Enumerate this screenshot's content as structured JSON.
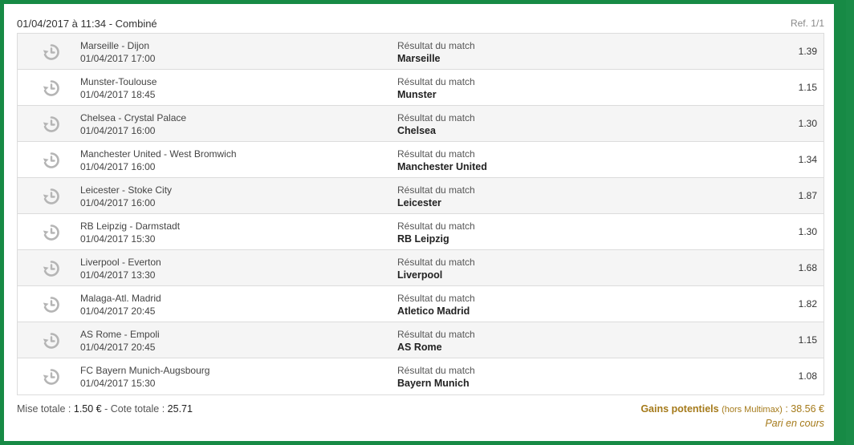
{
  "header": {
    "title": "01/04/2017 à 11:34 - Combiné",
    "ref": "Ref. 1/1"
  },
  "colors": {
    "frame": "#178a45",
    "row_alt": "#f5f5f5",
    "gains": "#a57a1a"
  },
  "icon": "history-icon",
  "bets": [
    {
      "match": "Marseille - Dijon",
      "date": "01/04/2017 17:00",
      "market": "Résultat du match",
      "pick": "Marseille",
      "odds": "1.39"
    },
    {
      "match": "Munster-Toulouse",
      "date": "01/04/2017 18:45",
      "market": "Résultat du match",
      "pick": "Munster",
      "odds": "1.15"
    },
    {
      "match": "Chelsea - Crystal Palace",
      "date": "01/04/2017 16:00",
      "market": "Résultat du match",
      "pick": "Chelsea",
      "odds": "1.30"
    },
    {
      "match": "Manchester United - West Bromwich",
      "date": "01/04/2017 16:00",
      "market": "Résultat du match",
      "pick": "Manchester United",
      "odds": "1.34"
    },
    {
      "match": "Leicester - Stoke City",
      "date": "01/04/2017 16:00",
      "market": "Résultat du match",
      "pick": "Leicester",
      "odds": "1.87"
    },
    {
      "match": "RB Leipzig - Darmstadt",
      "date": "01/04/2017 15:30",
      "market": "Résultat du match",
      "pick": "RB Leipzig",
      "odds": "1.30"
    },
    {
      "match": "Liverpool - Everton",
      "date": "01/04/2017 13:30",
      "market": "Résultat du match",
      "pick": "Liverpool",
      "odds": "1.68"
    },
    {
      "match": "Malaga-Atl. Madrid",
      "date": "01/04/2017 20:45",
      "market": "Résultat du match",
      "pick": "Atletico Madrid",
      "odds": "1.82"
    },
    {
      "match": "AS Rome - Empoli",
      "date": "01/04/2017 20:45",
      "market": "Résultat du match",
      "pick": "AS Rome",
      "odds": "1.15"
    },
    {
      "match": "FC Bayern Munich-Augsbourg",
      "date": "01/04/2017 15:30",
      "market": "Résultat du match",
      "pick": "Bayern Munich",
      "odds": "1.08"
    }
  ],
  "footer": {
    "stake_label": "Mise totale :",
    "stake_value": "1.50 €",
    "separator": "-",
    "odds_label": "Cote totale :",
    "odds_value": "25.71",
    "gains_label": "Gains potentiels",
    "gains_note": "(hors Multimax)",
    "gains_value": ": 38.56 €",
    "status": "Pari en cours"
  }
}
